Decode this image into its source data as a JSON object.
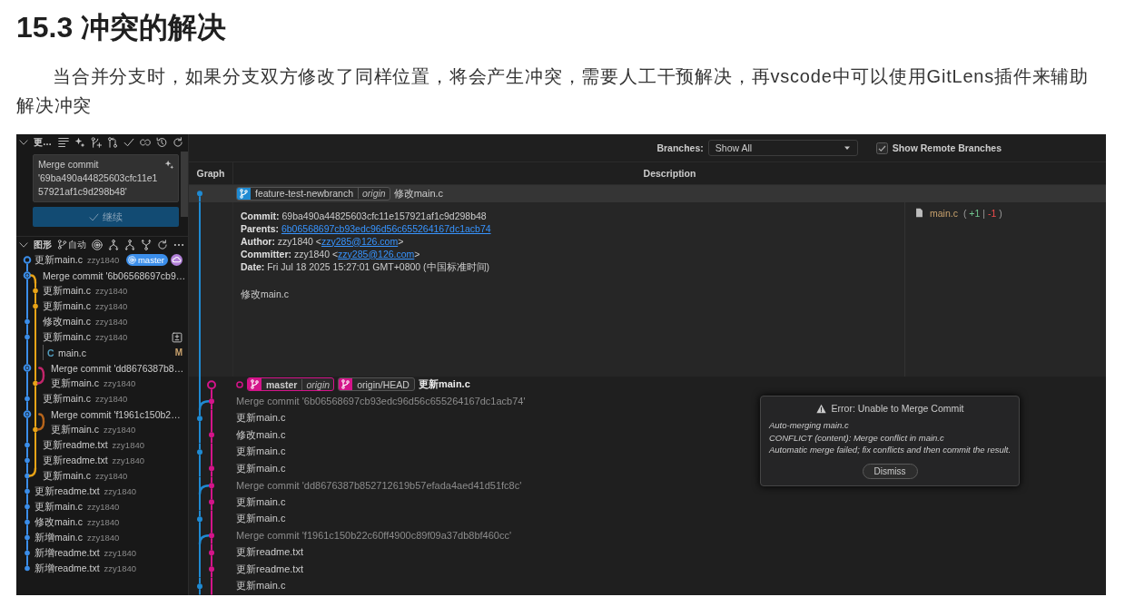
{
  "heading": "15.3 冲突的解决",
  "paragraph": "当合并分支时，如果分支双方修改了同样位置，将会产生冲突，需要人工干预解决，再vscode中可以使用GitLens插件来辅助解决冲突",
  "source_control": {
    "title": "更…",
    "commit_message": "Merge commit '69ba490a44825603cfc11e157921af1c9d298b48'",
    "continue_button": {
      "label": "继续",
      "disabled": true
    },
    "graph_title": "图形",
    "graph_branch": "自动",
    "commits": [
      {
        "message": "更新main.c",
        "author": "zzy1840",
        "expanded": false,
        "graph": [
          {
            "kind": "head",
            "color": "#3b8eea"
          }
        ],
        "refs": [
          {
            "kind": "local",
            "name": "master",
            "color": "#3b8eea"
          },
          {
            "kind": "remote",
            "color": "#b180d7"
          }
        ]
      },
      {
        "message": "Merge commit '6b06568697cb9…",
        "expanded": false,
        "graph": [
          {
            "kind": "ring",
            "color": "#3b8eea"
          },
          {
            "kind": "fork",
            "color": "#e8a317"
          }
        ]
      },
      {
        "message": "更新main.c",
        "author": "zzy1840",
        "expanded": false,
        "graph": [
          {
            "kind": "line",
            "color": "#3b8eea"
          },
          {
            "kind": "dot",
            "color": "#e8a317"
          }
        ]
      },
      {
        "message": "更新main.c",
        "author": "zzy1840",
        "expanded": false,
        "graph": [
          {
            "kind": "line",
            "color": "#3b8eea"
          },
          {
            "kind": "dot",
            "color": "#e8a317"
          }
        ]
      },
      {
        "message": "修改main.c",
        "author": "zzy1840",
        "expanded": false,
        "graph": [
          {
            "kind": "dot",
            "color": "#3b8eea"
          },
          {
            "kind": "line",
            "color": "#e8a317"
          }
        ]
      },
      {
        "message": "更新main.c",
        "author": "zzy1840",
        "expanded": true,
        "graph": [
          {
            "kind": "dot",
            "color": "#3b8eea"
          },
          {
            "kind": "line",
            "color": "#e8a317"
          }
        ],
        "children": [
          {
            "icon": "C",
            "name": "main.c",
            "status": "M",
            "graph": [
              {
                "kind": "line",
                "color": "#3b8eea"
              },
              {
                "kind": "line",
                "color": "#e8a317"
              }
            ]
          }
        ]
      },
      {
        "message": "Merge commit 'dd8676387b8…",
        "expanded": false,
        "graph": [
          {
            "kind": "ring",
            "color": "#3b8eea"
          },
          {
            "kind": "line",
            "color": "#e8a317"
          },
          {
            "kind": "fork",
            "color": "#c2256a"
          }
        ]
      },
      {
        "message": "更新main.c",
        "author": "zzy1840",
        "expanded": false,
        "graph": [
          {
            "kind": "line",
            "color": "#3b8eea"
          },
          {
            "kind": "dot",
            "color": "#e8a317"
          },
          {
            "kind": "join",
            "color": "#c2256a"
          }
        ]
      },
      {
        "message": "更新main.c",
        "author": "zzy1840",
        "expanded": false,
        "graph": [
          {
            "kind": "dot",
            "color": "#3b8eea"
          },
          {
            "kind": "line",
            "color": "#e8a317"
          }
        ]
      },
      {
        "message": "Merge commit 'f1961c150b2…",
        "expanded": false,
        "graph": [
          {
            "kind": "ring",
            "color": "#3b8eea"
          },
          {
            "kind": "line",
            "color": "#e8a317"
          },
          {
            "kind": "fork",
            "color": "#b8651b"
          }
        ]
      },
      {
        "message": "更新main.c",
        "author": "zzy1840",
        "expanded": false,
        "graph": [
          {
            "kind": "line",
            "color": "#3b8eea"
          },
          {
            "kind": "dot",
            "color": "#e8a317"
          },
          {
            "kind": "join",
            "color": "#b8651b"
          }
        ]
      },
      {
        "message": "更新readme.txt",
        "author": "zzy1840",
        "expanded": false,
        "graph": [
          {
            "kind": "dot",
            "color": "#3b8eea"
          },
          {
            "kind": "line",
            "color": "#e8a317"
          }
        ]
      },
      {
        "message": "更新readme.txt",
        "author": "zzy1840",
        "expanded": false,
        "graph": [
          {
            "kind": "dot",
            "color": "#3b8eea"
          },
          {
            "kind": "line",
            "color": "#e8a317"
          }
        ]
      },
      {
        "message": "更新main.c",
        "author": "zzy1840",
        "expanded": false,
        "graph": [
          {
            "kind": "dot",
            "color": "#3b8eea"
          },
          {
            "kind": "join",
            "color": "#e8a317"
          }
        ]
      },
      {
        "message": "更新readme.txt",
        "author": "zzy1840",
        "expanded": false,
        "graph": [
          {
            "kind": "dot",
            "color": "#3b8eea"
          }
        ]
      },
      {
        "message": "更新main.c",
        "author": "zzy1840",
        "expanded": false,
        "graph": [
          {
            "kind": "dot",
            "color": "#3b8eea"
          }
        ]
      },
      {
        "message": "修改main.c",
        "author": "zzy1840",
        "expanded": false,
        "graph": [
          {
            "kind": "dot",
            "color": "#3b8eea"
          }
        ]
      },
      {
        "message": "新增main.c",
        "author": "zzy1840",
        "expanded": false,
        "graph": [
          {
            "kind": "dot",
            "color": "#3b8eea"
          }
        ]
      },
      {
        "message": "新增readme.txt",
        "author": "zzy1840",
        "expanded": false,
        "graph": [
          {
            "kind": "dot",
            "color": "#3b8eea"
          }
        ]
      },
      {
        "message": "新增readme.txt",
        "author": "zzy1840",
        "expanded": false,
        "graph": [
          {
            "kind": "end",
            "color": "#3b8eea"
          }
        ]
      }
    ]
  },
  "graph_view": {
    "branches_label": "Branches:",
    "branches_select": "Show All",
    "remote_checkbox": {
      "label": "Show Remote Branches",
      "checked": true
    },
    "columns": [
      "Graph",
      "Description"
    ],
    "commits": [
      {
        "kind": "commit",
        "selected": true,
        "message": "修改main.c",
        "refs": [
          {
            "name": "feature-test-newbranch",
            "remote": "origin",
            "color": "#1f8ad2",
            "current": false
          }
        ],
        "graph": [
          {
            "kind": "start",
            "color": "#1f8ad2"
          }
        ],
        "details": {
          "graph": [
            {
              "kind": "line",
              "color": "#1f8ad2"
            }
          ],
          "fields": [
            {
              "label": "Commit:",
              "value": "69ba490a44825603cfc11e157921af1c9d298b48"
            },
            {
              "label": "Parents:",
              "link": "6b06568697cb93edc96d56c655264167dc1acb74"
            },
            {
              "label": "Author:",
              "value": "zzy1840 <",
              "link": "zzy285@126.com",
              "after": ">"
            },
            {
              "label": "Committer:",
              "value": "zzy1840 <",
              "link": "zzy285@126.com",
              "after": ">"
            },
            {
              "label": "Date:",
              "value": "Fri Jul 18 2025 15:27:01 GMT+0800 (中国标准时间)"
            }
          ],
          "message": "修改main.c",
          "files": [
            {
              "name": "main.c",
              "open": "(",
              "added": "+1",
              "separator": "|",
              "removed": "-1",
              "close": ")"
            }
          ]
        }
      },
      {
        "kind": "head",
        "selected": false,
        "message": "更新main.c",
        "refs": [
          {
            "name": "master",
            "remote": "origin",
            "color": "#d4148a",
            "current": true
          },
          {
            "name": "origin/HEAD",
            "color": "#d4148a",
            "current": false
          }
        ],
        "graph": [
          {
            "kind": "line",
            "color": "#1f8ad2"
          },
          {
            "kind": "head",
            "color": "#d4148a"
          }
        ]
      },
      {
        "kind": "merge",
        "selected": false,
        "message": "Merge commit '6b06568697cb93edc96d56c655264167dc1acb74'",
        "graph": [
          {
            "kind": "branch",
            "color": "#1f8ad2"
          },
          {
            "kind": "dot",
            "color": "#d4148a"
          }
        ]
      },
      {
        "kind": "commit",
        "selected": false,
        "message": "更新main.c",
        "graph": [
          {
            "kind": "dot",
            "color": "#1f8ad2"
          },
          {
            "kind": "line",
            "color": "#d4148a"
          }
        ]
      },
      {
        "kind": "commit",
        "selected": false,
        "message": "修改main.c",
        "graph": [
          {
            "kind": "line",
            "color": "#1f8ad2"
          },
          {
            "kind": "dot",
            "color": "#d4148a"
          }
        ]
      },
      {
        "kind": "commit",
        "selected": false,
        "message": "更新main.c",
        "graph": [
          {
            "kind": "dot",
            "color": "#1f8ad2"
          },
          {
            "kind": "line",
            "color": "#d4148a"
          }
        ]
      },
      {
        "kind": "commit",
        "selected": false,
        "message": "更新main.c",
        "graph": [
          {
            "kind": "line",
            "color": "#1f8ad2"
          },
          {
            "kind": "dot",
            "color": "#d4148a"
          }
        ]
      },
      {
        "kind": "merge",
        "selected": false,
        "message": "Merge commit 'dd8676387b852712619b57efada4aed41d51fc8c'",
        "graph": [
          {
            "kind": "branch",
            "color": "#1f8ad2"
          },
          {
            "kind": "dot",
            "color": "#d4148a"
          }
        ]
      },
      {
        "kind": "commit",
        "selected": false,
        "message": "更新main.c",
        "graph": [
          {
            "kind": "line",
            "color": "#1f8ad2"
          },
          {
            "kind": "dot",
            "color": "#d4148a"
          }
        ]
      },
      {
        "kind": "commit",
        "selected": false,
        "message": "更新main.c",
        "graph": [
          {
            "kind": "dot",
            "color": "#1f8ad2"
          },
          {
            "kind": "line",
            "color": "#d4148a"
          }
        ]
      },
      {
        "kind": "merge",
        "selected": false,
        "message": "Merge commit 'f1961c150b22c60ff4900c89f09a37db8bf460cc'",
        "graph": [
          {
            "kind": "branch",
            "color": "#1f8ad2"
          },
          {
            "kind": "dot",
            "color": "#d4148a"
          }
        ]
      },
      {
        "kind": "commit",
        "selected": false,
        "message": "更新readme.txt",
        "graph": [
          {
            "kind": "line",
            "color": "#1f8ad2"
          },
          {
            "kind": "dot",
            "color": "#d4148a"
          }
        ]
      },
      {
        "kind": "commit",
        "selected": false,
        "message": "更新readme.txt",
        "graph": [
          {
            "kind": "line",
            "color": "#1f8ad2"
          },
          {
            "kind": "dot",
            "color": "#d4148a"
          }
        ]
      },
      {
        "kind": "commit",
        "selected": false,
        "message": "更新main.c",
        "graph": [
          {
            "kind": "dot",
            "color": "#1f8ad2"
          },
          {
            "kind": "line",
            "color": "#d4148a"
          }
        ]
      }
    ],
    "dialog": {
      "title": "Error: Unable to Merge Commit",
      "lines": [
        "Auto-merging main.c",
        "CONFLICT (content): Merge conflict in main.c",
        "Automatic merge failed; fix conflicts and then commit the result."
      ],
      "button": "Dismiss"
    }
  }
}
